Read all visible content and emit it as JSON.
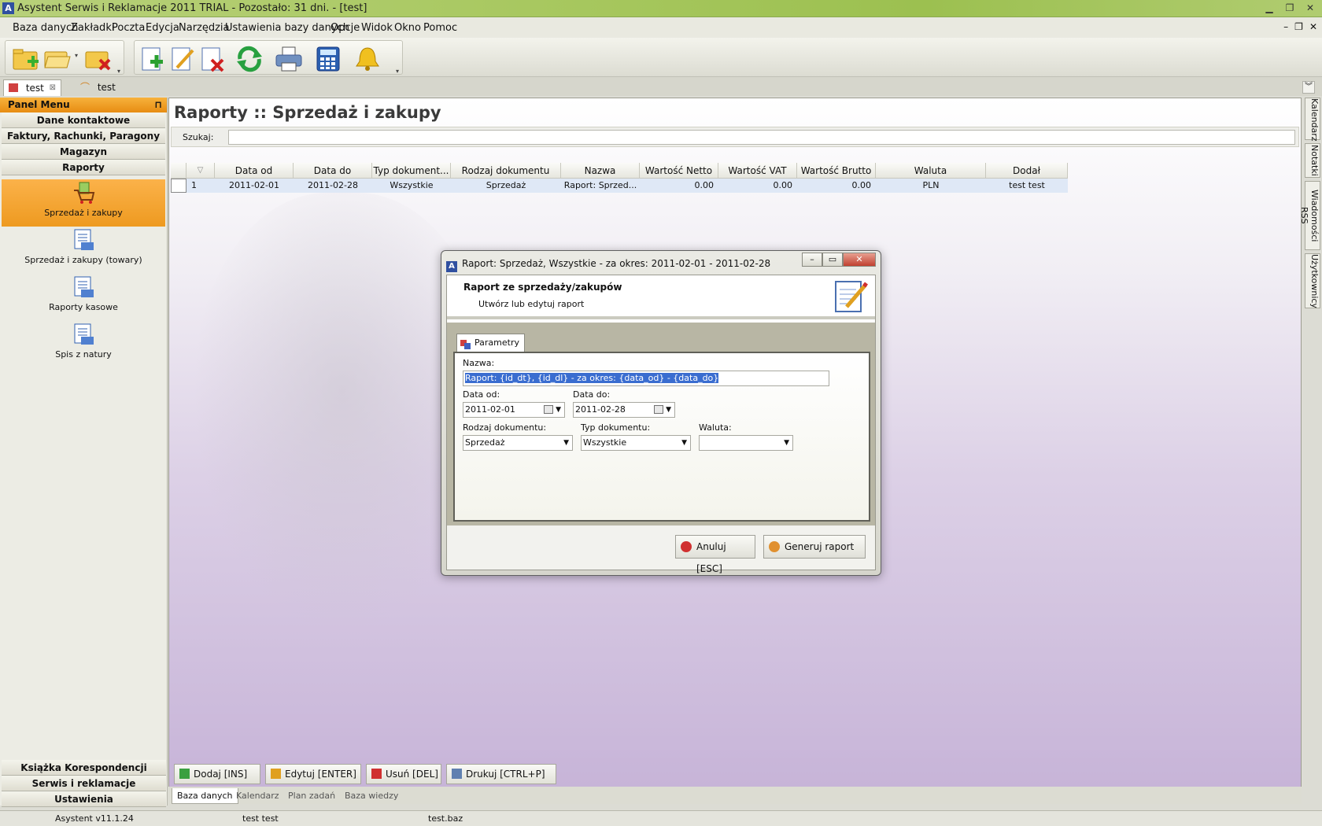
{
  "window": {
    "title": "Asystent Serwis i Reklamacje 2011 TRIAL - Pozostało: 31 dni. - [test]",
    "app_icon": "A"
  },
  "menu": [
    "Baza danych",
    "Zakładki",
    "Poczta",
    "Edycja",
    "Narzędzia",
    "Ustawienia bazy danych",
    "Opcje",
    "Widok",
    "Okno",
    "Pomoc"
  ],
  "toolbar": {
    "icons": [
      "new-database-icon",
      "open-folder-icon",
      "delete-database-icon",
      "add-record-icon",
      "edit-record-icon",
      "delete-record-icon",
      "refresh-icon",
      "print-icon",
      "calculator-icon",
      "bell-icon"
    ]
  },
  "doc_tabs": [
    {
      "label": "test",
      "active": true
    },
    {
      "label": "test",
      "active": false
    }
  ],
  "left_panel": {
    "header": "Panel Menu",
    "sections_top": [
      "Dane kontaktowe",
      "Faktury, Rachunki, Paragony",
      "Magazyn",
      "Raporty"
    ],
    "items": [
      {
        "label": "Sprzedaż i zakupy",
        "active": true
      },
      {
        "label": "Sprzedaż i zakupy (towary)",
        "active": false
      },
      {
        "label": "Raporty kasowe",
        "active": false
      },
      {
        "label": "Spis z natury",
        "active": false
      }
    ],
    "sections_bottom": [
      "Książka Korespondencji",
      "Serwis i reklamacje",
      "Ustawienia"
    ]
  },
  "main": {
    "title": "Raporty :: Sprzedaż i zakupy",
    "search_label": "Szukaj:",
    "search_value": "",
    "columns": [
      "Data od",
      "Data do",
      "Typ dokument...",
      "Rodzaj dokumentu",
      "Nazwa",
      "Wartość Netto",
      "Wartość VAT",
      "Wartość Brutto",
      "Waluta",
      "Dodał"
    ],
    "rows": [
      {
        "no": "1",
        "data_od": "2011-02-01",
        "data_do": "2011-02-28",
        "typ": "Wszystkie",
        "rodzaj": "Sprzedaż",
        "nazwa": "Raport: Sprzed...",
        "netto": "0.00",
        "vat": "0.00",
        "brutto": "0.00",
        "waluta": "PLN",
        "dodal": "test test"
      }
    ],
    "buttons": [
      "Dodaj [INS]",
      "Edytuj [ENTER]",
      "Usuń [DEL]",
      "Drukuj [CTRL+P]"
    ],
    "bottom_tabs": [
      "Baza danych",
      "Kalendarz",
      "Plan zadań",
      "Baza wiedzy"
    ]
  },
  "side_tabs": [
    "Kalendarz",
    "Notatki",
    "Wiadomości RSS",
    "Użytkownicy"
  ],
  "status": {
    "version": "Asystent v11.1.24",
    "user": "test test",
    "db": "test.baz"
  },
  "dialog": {
    "title": "Raport: Sprzedaż, Wszystkie - za okres: 2011-02-01  -  2011-02-28",
    "heading": "Raport ze sprzedaży/zakupów",
    "subheading": "Utwórz lub edytuj raport",
    "tab": "Parametry",
    "nazwa_label": "Nazwa:",
    "nazwa_value": "Raport: {id_dt}, {id_dl} - za okres: {data_od}  -  {data_do}",
    "data_od_label": "Data od:",
    "data_od_value": "2011-02-01",
    "data_do_label": "Data do:",
    "data_do_value": "2011-02-28",
    "rodzaj_label": "Rodzaj dokumentu:",
    "rodzaj_value": "Sprzedaż",
    "typ_label": "Typ dokumentu:",
    "typ_value": "Wszystkie",
    "waluta_label": "Waluta:",
    "waluta_value": "",
    "cancel": "Anuluj [ESC]",
    "generate": "Generuj raport"
  }
}
